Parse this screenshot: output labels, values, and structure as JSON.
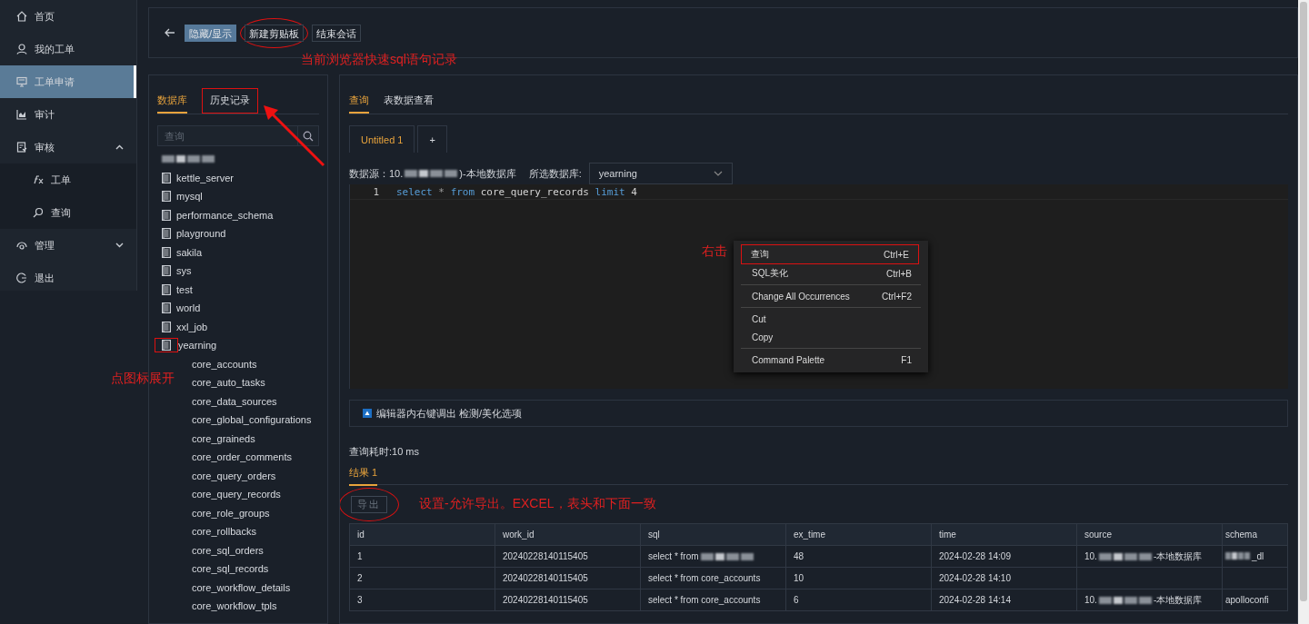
{
  "sidebar": {
    "items": [
      {
        "label": "首页",
        "selected": false
      },
      {
        "label": "我的工单",
        "selected": false
      },
      {
        "label": "工单申请",
        "selected": true
      },
      {
        "label": "审计",
        "selected": false
      },
      {
        "label": "审核",
        "selected": false,
        "expanded": true,
        "children": [
          {
            "label": "工单",
            "selected": false
          },
          {
            "label": "查询",
            "selected": false
          }
        ]
      },
      {
        "label": "管理",
        "selected": false,
        "expanded": false
      },
      {
        "label": "退出",
        "selected": false
      }
    ]
  },
  "toolbar": {
    "buttons": [
      {
        "label": "隐藏/显示",
        "primary": true,
        "annotated": false
      },
      {
        "label": "新建剪贴板",
        "primary": false,
        "annotated": true
      },
      {
        "label": "结束会话",
        "primary": false,
        "annotated": false
      }
    ],
    "note": "当前浏览器快速sql语句记录"
  },
  "left_panel": {
    "tabs": [
      {
        "label": "数据库",
        "selected": true,
        "annotated": false
      },
      {
        "label": "历史记录",
        "selected": false,
        "annotated": true
      }
    ],
    "search": {
      "placeholder": "查询"
    },
    "tree": [
      {
        "kind": "blurred"
      },
      {
        "kind": "database",
        "label": "kettle_server"
      },
      {
        "kind": "database",
        "label": "mysql"
      },
      {
        "kind": "database",
        "label": "performance_schema"
      },
      {
        "kind": "database",
        "label": "playground"
      },
      {
        "kind": "database",
        "label": "sakila"
      },
      {
        "kind": "database",
        "label": "sys"
      },
      {
        "kind": "database",
        "label": "test"
      },
      {
        "kind": "database",
        "label": "world"
      },
      {
        "kind": "database",
        "label": "xxl_job"
      },
      {
        "kind": "database",
        "label": "yearning",
        "annotated": true,
        "children": [
          {
            "label": "core_accounts"
          },
          {
            "label": "core_auto_tasks"
          },
          {
            "label": "core_data_sources"
          },
          {
            "label": "core_global_configurations"
          },
          {
            "label": "core_graineds"
          },
          {
            "label": "core_order_comments"
          },
          {
            "label": "core_query_orders"
          },
          {
            "label": "core_query_records"
          },
          {
            "label": "core_role_groups"
          },
          {
            "label": "core_rollbacks"
          },
          {
            "label": "core_sql_orders"
          },
          {
            "label": "core_sql_records"
          },
          {
            "label": "core_workflow_details"
          },
          {
            "label": "core_workflow_tpls"
          }
        ]
      }
    ],
    "note": "点图标展开"
  },
  "right_panel": {
    "tabs": [
      {
        "label": "查询",
        "selected": true
      },
      {
        "label": "表数据查看",
        "selected": false
      }
    ],
    "editor_tabs": [
      {
        "label": "Untitled 1",
        "selected": true
      },
      {
        "label": "+",
        "selected": false
      }
    ],
    "datasource": {
      "label": "数据源：",
      "value_start": "10.",
      "value_end": ")-本地数据库",
      "db_label": "所选数据库:",
      "db_value": "yearning"
    },
    "editor": {
      "lines": [
        {
          "number": "1",
          "tokens": [
            {
              "text": "select",
              "kind": "keyword"
            },
            {
              "text": " * ",
              "kind": "operator"
            },
            {
              "text": "from",
              "kind": "keyword"
            },
            {
              "text": " core_query_records ",
              "kind": "plain"
            },
            {
              "text": "limit",
              "kind": "keyword"
            },
            {
              "text": " 4",
              "kind": "plain"
            }
          ]
        }
      ]
    },
    "context_menu": {
      "note": "右击",
      "groups": [
        [
          {
            "label": "查询",
            "shortcut": "Ctrl+E",
            "annotated": true
          },
          {
            "label": "SQL美化",
            "shortcut": "Ctrl+B",
            "annotated": false
          }
        ],
        [
          {
            "label": "Change All Occurrences",
            "shortcut": "Ctrl+F2",
            "annotated": false
          }
        ],
        [
          {
            "label": "Cut",
            "annotated": false
          },
          {
            "label": "Copy",
            "annotated": false
          }
        ],
        [
          {
            "label": "Command Palette",
            "shortcut": "F1",
            "annotated": false
          }
        ]
      ]
    },
    "tip": "编辑器内右键调出 检测/美化选项",
    "query_time": "查询耗时:10 ms",
    "result_tabs": [
      {
        "label": "结果 1",
        "selected": true
      }
    ],
    "export": {
      "label": "导出",
      "disabled": true,
      "annotated": true,
      "note": "设置-允许导出。EXCEL，表头和下面一致"
    },
    "table": {
      "columns": [
        "id",
        "work_id",
        "sql",
        "ex_time",
        "time",
        "source",
        "schema"
      ],
      "rows": [
        [
          {
            "text": "1"
          },
          {
            "text": "20240228140115405"
          },
          {
            "text": "select * from ",
            "blur": true
          },
          {
            "text": "48"
          },
          {
            "text": "2024-02-28 14:09"
          },
          {
            "text": "10.",
            "blur": true,
            "rest": "-本地数据库"
          },
          {
            "text": "",
            "blur": true,
            "rest": "_dl"
          }
        ],
        [
          {
            "text": "2"
          },
          {
            "text": "20240228140115405"
          },
          {
            "text": "select * from core_accounts"
          },
          {
            "text": "10"
          },
          {
            "text": "2024-02-28 14:10"
          },
          {
            "text": ""
          },
          {
            "text": ""
          }
        ],
        [
          {
            "text": "3"
          },
          {
            "text": "20240228140115405"
          },
          {
            "text": "select * from core_accounts"
          },
          {
            "text": "6"
          },
          {
            "text": "2024-02-28 14:14"
          },
          {
            "text": "10.",
            "blur": true,
            "rest": "-本地数据库"
          },
          {
            "text": "apolloconfi"
          }
        ]
      ]
    }
  }
}
